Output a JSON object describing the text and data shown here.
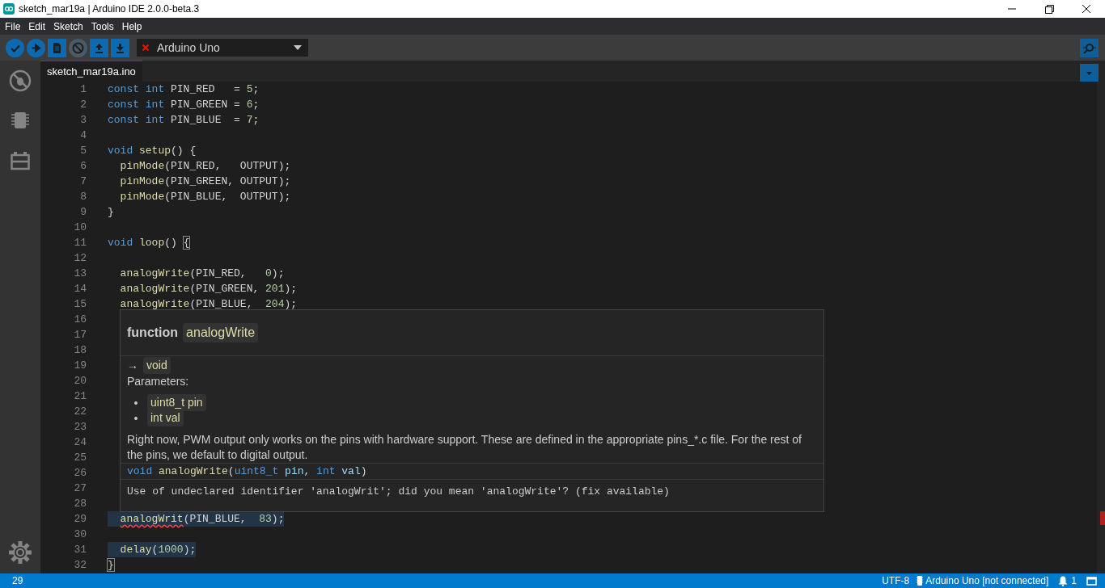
{
  "window": {
    "title": "sketch_mar19a | Arduino IDE 2.0.0-beta.3"
  },
  "menu": [
    "File",
    "Edit",
    "Sketch",
    "Tools",
    "Help"
  ],
  "toolbar": {
    "buttons": [
      {
        "kind": "verify",
        "disabled": false
      },
      {
        "kind": "upload",
        "disabled": false
      },
      {
        "kind": "new",
        "disabled": false
      },
      {
        "kind": "debug",
        "disabled": true
      },
      {
        "kind": "open",
        "disabled": false
      },
      {
        "kind": "save",
        "disabled": false
      }
    ],
    "board": {
      "name": "Arduino Uno",
      "connected": false
    }
  },
  "tabs": [
    {
      "label": "sketch_mar19a.ino",
      "selected": true
    }
  ],
  "editor": {
    "lines": [
      {
        "number": "1",
        "highlighted": false,
        "tokens": [
          {
            "text": "const ",
            "kind": "kw"
          },
          {
            "text": "int",
            "kind": "kw"
          },
          {
            "text": " PIN_RED   = ",
            "kind": "plain"
          },
          {
            "text": "5",
            "kind": "num"
          },
          {
            "text": ";",
            "kind": "plain"
          }
        ]
      },
      {
        "number": "2",
        "highlighted": false,
        "tokens": [
          {
            "text": "const ",
            "kind": "kw"
          },
          {
            "text": "int",
            "kind": "kw"
          },
          {
            "text": " PIN_GREEN = ",
            "kind": "plain"
          },
          {
            "text": "6",
            "kind": "num"
          },
          {
            "text": ";",
            "kind": "plain"
          }
        ]
      },
      {
        "number": "3",
        "highlighted": false,
        "tokens": [
          {
            "text": "const ",
            "kind": "kw"
          },
          {
            "text": "int",
            "kind": "kw"
          },
          {
            "text": " PIN_BLUE  = ",
            "kind": "plain"
          },
          {
            "text": "7",
            "kind": "num"
          },
          {
            "text": ";",
            "kind": "plain"
          }
        ]
      },
      {
        "number": "4"
      },
      {
        "number": "5",
        "highlighted": false,
        "tokens": [
          {
            "text": "void ",
            "kind": "kw"
          },
          {
            "text": "setup",
            "kind": "fn"
          },
          {
            "text": "() {",
            "kind": "plain"
          }
        ]
      },
      {
        "number": "6",
        "highlighted": false,
        "tokens": [
          {
            "text": "  pinMode",
            "kind": "fn"
          },
          {
            "text": "(PIN_RED,   OUTPUT);",
            "kind": "plain"
          }
        ]
      },
      {
        "number": "7",
        "highlighted": false,
        "tokens": [
          {
            "text": "  pinMode",
            "kind": "fn"
          },
          {
            "text": "(PIN_GREEN, OUTPUT);",
            "kind": "plain"
          }
        ]
      },
      {
        "number": "8",
        "highlighted": false,
        "tokens": [
          {
            "text": "  pinMode",
            "kind": "fn"
          },
          {
            "text": "(PIN_BLUE,  OUTPUT);",
            "kind": "plain"
          }
        ]
      },
      {
        "number": "9",
        "highlighted": false,
        "tokens": [
          {
            "text": "}",
            "kind": "plain"
          }
        ]
      },
      {
        "number": "10"
      },
      {
        "number": "11",
        "highlighted": false,
        "tokens": [
          {
            "text": "void ",
            "kind": "kw"
          },
          {
            "text": "loop",
            "kind": "fn"
          },
          {
            "text": "() ",
            "kind": "plain"
          },
          {
            "text": "{",
            "kind": "match"
          }
        ]
      },
      {
        "number": "12"
      },
      {
        "number": "13",
        "highlighted": false,
        "tokens": [
          {
            "text": "  analogWrite",
            "kind": "fn"
          },
          {
            "text": "(PIN_RED,   ",
            "kind": "plain"
          },
          {
            "text": "0",
            "kind": "num"
          },
          {
            "text": ");",
            "kind": "plain"
          }
        ]
      },
      {
        "number": "14",
        "highlighted": false,
        "tokens": [
          {
            "text": "  analogWrite",
            "kind": "fn"
          },
          {
            "text": "(PIN_GREEN, ",
            "kind": "plain"
          },
          {
            "text": "201",
            "kind": "num"
          },
          {
            "text": ");",
            "kind": "plain"
          }
        ]
      },
      {
        "number": "15",
        "highlighted": false,
        "tokens": [
          {
            "text": "  analogWrite",
            "kind": "fn"
          },
          {
            "text": "(PIN_BLUE,  ",
            "kind": "plain"
          },
          {
            "text": "204",
            "kind": "num"
          },
          {
            "text": ");",
            "kind": "plain"
          }
        ]
      },
      {
        "number": "16"
      },
      {
        "number": "17"
      },
      {
        "number": "18"
      },
      {
        "number": "19"
      },
      {
        "number": "20"
      },
      {
        "number": "21"
      },
      {
        "number": "22"
      },
      {
        "number": "23"
      },
      {
        "number": "24"
      },
      {
        "number": "25"
      },
      {
        "number": "26"
      },
      {
        "number": "27"
      },
      {
        "number": "28"
      },
      {
        "number": "29",
        "highlighted": true,
        "tokens": [
          {
            "text": "  analogWrit",
            "kind": "error"
          },
          {
            "text": "(PIN_BLUE,  ",
            "kind": "plain"
          },
          {
            "text": "83",
            "kind": "num"
          },
          {
            "text": ");",
            "kind": "plain"
          }
        ]
      },
      {
        "number": "30"
      },
      {
        "number": "31",
        "highlighted": true,
        "tokens": [
          {
            "text": "  delay",
            "kind": "fn"
          },
          {
            "text": "(",
            "kind": "plain"
          },
          {
            "text": "1000",
            "kind": "num"
          },
          {
            "text": ");",
            "kind": "plain"
          }
        ]
      },
      {
        "number": "32",
        "highlighted": false,
        "tokens": [
          {
            "text": "}",
            "kind": "match"
          }
        ]
      }
    ]
  },
  "hover": {
    "kind_label": "function",
    "name": "analogWrite",
    "returns_arrow": "→",
    "returns": "void",
    "params_label": "Parameters:",
    "params": [
      "uint8_t pin",
      "int val"
    ],
    "description": "Right now, PWM output only works on the pins with hardware support. These are defined in the appropriate pins_*.c file. For the rest of the pins, we default to digital output.",
    "signature": [
      {
        "text": "void ",
        "kind": "kw"
      },
      {
        "text": "analogWrite",
        "kind": "fn"
      },
      {
        "text": "(",
        "kind": "plain"
      },
      {
        "text": "uint8_t ",
        "kind": "kw"
      },
      {
        "text": "pin",
        "kind": "param"
      },
      {
        "text": ", ",
        "kind": "plain"
      },
      {
        "text": "int ",
        "kind": "kw"
      },
      {
        "text": "val",
        "kind": "param"
      },
      {
        "text": ")",
        "kind": "plain"
      }
    ],
    "diagnostic": "Use of undeclared identifier 'analogWrit'; did you mean 'analogWrite'? (fix available)"
  },
  "status_bar": {
    "line": "29",
    "encoding": "UTF-8",
    "board": "Arduino Uno [not connected]",
    "notifications": "1"
  }
}
